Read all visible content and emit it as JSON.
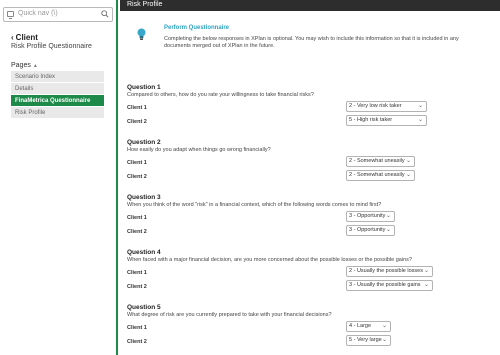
{
  "sidebar": {
    "quicknav_placeholder": "Quick nav (\\)",
    "back_label": "Client",
    "context_title": "Risk Profile Questionnaire",
    "pages_header": "Pages",
    "pages": [
      "Scenario Index",
      "Details",
      "FinaMetrica Questionnaire",
      "Risk Profile"
    ],
    "active_page": "FinaMetrica Questionnaire"
  },
  "header": {
    "title": "Risk Profile"
  },
  "info": {
    "title": "Perform Questionnaire",
    "text": "Completing the below responses in XPlan is optional. You may wish to include this information so that it is included in any documents merged out of XPlan in the future."
  },
  "questions": [
    {
      "title": "Question 1",
      "text": "Compared to others, how do you rate your willingness to take financial risks?",
      "client1_label": "Client 1",
      "client1_value": "2 - Very low risk taker",
      "client2_label": "Client 2",
      "client2_value": "5 - High risk taker"
    },
    {
      "title": "Question 2",
      "text": "How easily do you adapt when things go wrong financially?",
      "client1_label": "Client 1",
      "client1_value": "2 - Somewhat uneasily",
      "client2_label": "Client 2",
      "client2_value": "2 - Somewhat uneasily"
    },
    {
      "title": "Question 3",
      "text": "When you think of the word \"risk\" in a financial context, which of the following words comes to mind first?",
      "client1_label": "Client 1",
      "client1_value": "3 - Opportunity",
      "client2_label": "Client 2",
      "client2_value": "3 - Opportunity"
    },
    {
      "title": "Question 4",
      "text": "When faced with a major financial decision, are you more concerned about the possible losses or the possible gains?",
      "client1_label": "Client 1",
      "client1_value": "2 - Usually the possible losses",
      "client2_label": "Client 2",
      "client2_value": "3 - Usually the possible gains"
    },
    {
      "title": "Question 5",
      "text": "What degree of risk are you currently prepared to take with your financial decisions?",
      "client1_label": "Client 1",
      "client1_value": "4 - Large",
      "client2_label": "Client 2",
      "client2_value": "5 - Very large"
    }
  ],
  "colors": {
    "accent": "#1e8a4a",
    "header_bg": "#2d2d2d",
    "info_title": "#2fa3c4"
  },
  "icons": {
    "quicknav": "monitor-icon",
    "search": "search-icon",
    "info": "lightbulb-icon"
  }
}
